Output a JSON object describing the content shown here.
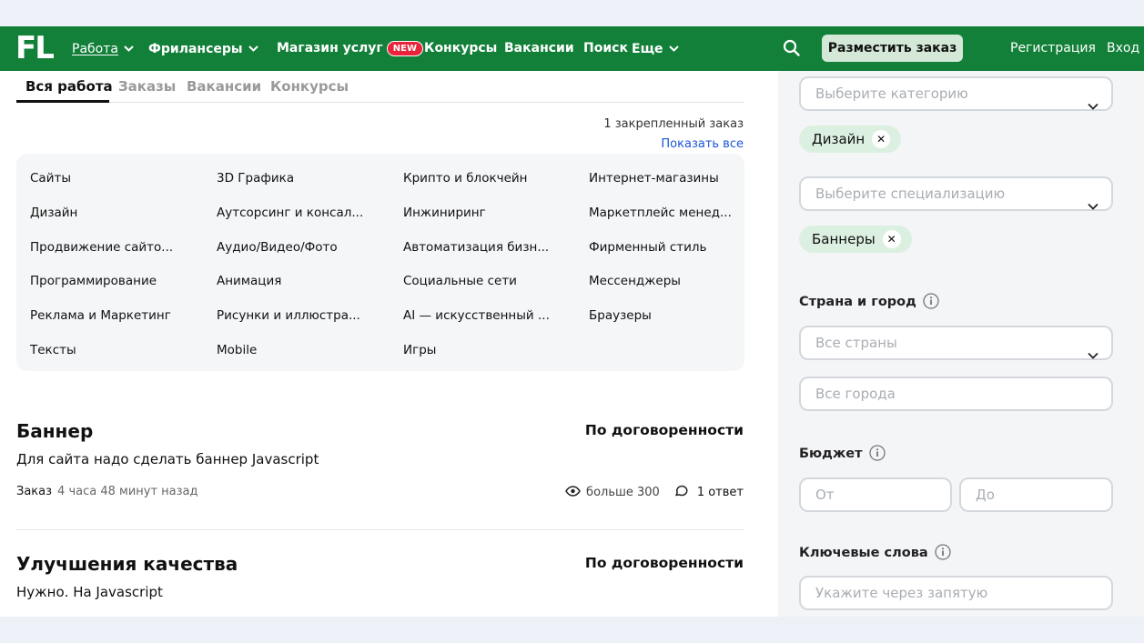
{
  "header": {
    "logo": "FL",
    "nav": [
      {
        "label": "Работа",
        "dropdown": true,
        "active": true
      },
      {
        "label": "Фрилансеры",
        "dropdown": true
      },
      {
        "label": "Магазин услуг",
        "badge": "NEW"
      },
      {
        "label": "Конкурсы"
      },
      {
        "label": "Вакансии"
      },
      {
        "label": "Поиск"
      },
      {
        "label": "Еще",
        "dropdown": true
      }
    ],
    "search_icon": "search-icon",
    "post_order": "Разместить заказ",
    "register": "Регистрация",
    "login": "Вход"
  },
  "tabs": [
    "Вся работа",
    "Заказы",
    "Вакансии",
    "Конкурсы"
  ],
  "active_tab": "Вся работа",
  "pinned": {
    "count_text": "1 закрепленный заказ",
    "show_all": "Показать все"
  },
  "categories": [
    [
      "Сайты",
      "3D Графика",
      "Крипто и блокчейн",
      "Интернет-магазины"
    ],
    [
      "Дизайн",
      "Аутсорсинг и консал...",
      "Инжиниринг",
      "Маркетплейс менед..."
    ],
    [
      "Продвижение сайто...",
      "Аудио/Видео/Фото",
      "Автоматизация бизн...",
      "Фирменный стиль"
    ],
    [
      "Программирование",
      "Анимация",
      "Социальные сети",
      "Мессенджеры"
    ],
    [
      "Реклама и Маркетинг",
      "Рисунки и иллюстра...",
      "AI — искусственный ...",
      "Браузеры"
    ],
    [
      "Тексты",
      "Mobile",
      "Игры",
      ""
    ]
  ],
  "jobs": [
    {
      "title": "Баннер",
      "price": "По договоренности",
      "description": "Для сайта надо сделать баннер Javascript",
      "type": "Заказ",
      "time": "4 часа 48 минут назад",
      "views": "больше 300",
      "answers": "1 ответ"
    },
    {
      "title": "Улучшения качества",
      "price": "По договоренности",
      "description": "Нужно. На Javascript"
    }
  ],
  "filters": {
    "category_placeholder": "Выберите категорию",
    "category_chip": "Дизайн",
    "specialization_placeholder": "Выберите специализацию",
    "specialization_chip": "Баннеры",
    "location_label": "Страна и город",
    "country_placeholder": "Все страны",
    "city_placeholder": "Все города",
    "budget_label": "Бюджет",
    "budget_from": "От",
    "budget_to": "До",
    "keywords_label": "Ключевые слова",
    "keywords_placeholder": "Укажите через запятую"
  },
  "colors": {
    "brand_green": "#13803a",
    "badge_red": "#e8233a",
    "link_blue": "#1a56d6",
    "chip_green": "#dcf0e1"
  }
}
